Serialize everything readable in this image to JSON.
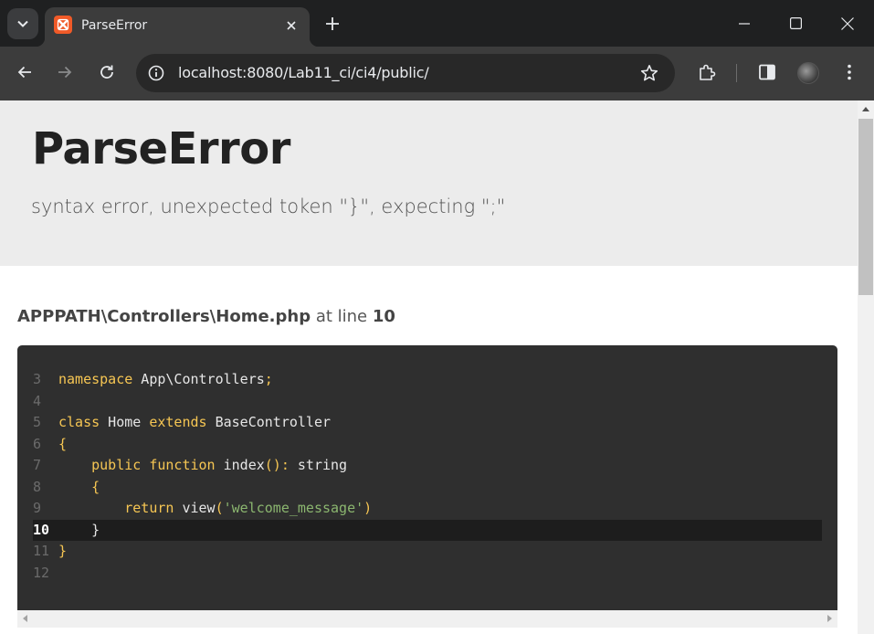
{
  "browser": {
    "tab": {
      "title": "ParseError",
      "favicon": "xampp-icon"
    },
    "url": "localhost:8080/Lab11_ci/ci4/public/",
    "icons": {
      "tab_search": "chevron-down-icon",
      "close_tab": "close-icon",
      "new_tab": "plus-icon",
      "minimize": "minimize-icon",
      "maximize": "maximize-icon",
      "close_window": "close-icon",
      "back": "arrow-left-icon",
      "forward": "arrow-right-icon",
      "reload": "reload-icon",
      "site_info": "info-icon",
      "bookmark": "star-icon",
      "extensions": "puzzle-icon",
      "side_panel": "side-panel-icon",
      "profile": "avatar",
      "menu": "kebab-menu-icon"
    },
    "colors": {
      "tabbar": "#1f2021",
      "toolbar": "#3c3c3c",
      "favicon": "#f05a28"
    }
  },
  "error": {
    "title": "ParseError",
    "message": "syntax error, unexpected token \"}\", expecting \";\"",
    "file": "APPPATH\\Controllers\\Home.php",
    "at_line_label": "at line",
    "line": "10"
  },
  "code": {
    "highlight_line": 10,
    "lines": [
      {
        "number": "3",
        "tokens": [
          {
            "t": "namespace",
            "c": "kw"
          },
          {
            "t": " App\\Controllers",
            "c": "pl"
          },
          {
            "t": ";",
            "c": "kw"
          }
        ]
      },
      {
        "number": "4",
        "tokens": []
      },
      {
        "number": "5",
        "tokens": [
          {
            "t": "class",
            "c": "kw"
          },
          {
            "t": " Home ",
            "c": "pl"
          },
          {
            "t": "extends",
            "c": "kw"
          },
          {
            "t": " BaseController",
            "c": "pl"
          }
        ]
      },
      {
        "number": "6",
        "tokens": [
          {
            "t": "{",
            "c": "kw"
          }
        ]
      },
      {
        "number": "7",
        "tokens": [
          {
            "t": "    ",
            "c": "pl"
          },
          {
            "t": "public",
            "c": "kw"
          },
          {
            "t": " ",
            "c": "pl"
          },
          {
            "t": "function",
            "c": "kw"
          },
          {
            "t": " index",
            "c": "pl"
          },
          {
            "t": "():",
            "c": "kw"
          },
          {
            "t": " string",
            "c": "pl"
          }
        ]
      },
      {
        "number": "8",
        "tokens": [
          {
            "t": "    ",
            "c": "pl"
          },
          {
            "t": "{",
            "c": "kw"
          }
        ]
      },
      {
        "number": "9",
        "tokens": [
          {
            "t": "        ",
            "c": "pl"
          },
          {
            "t": "return",
            "c": "kw"
          },
          {
            "t": " view",
            "c": "pl"
          },
          {
            "t": "(",
            "c": "kw"
          },
          {
            "t": "'welcome_message'",
            "c": "str"
          },
          {
            "t": ")",
            "c": "kw"
          }
        ]
      },
      {
        "number": "10",
        "tokens": [
          {
            "t": "    }",
            "c": "pl"
          }
        ]
      },
      {
        "number": "11",
        "tokens": [
          {
            "t": "}",
            "c": "kw"
          }
        ]
      },
      {
        "number": "12",
        "tokens": []
      }
    ]
  },
  "colors": {
    "keyword": "#f6c653",
    "string": "#8bb66f",
    "code_bg": "#2f2f2f",
    "header_bg": "#ececec"
  }
}
